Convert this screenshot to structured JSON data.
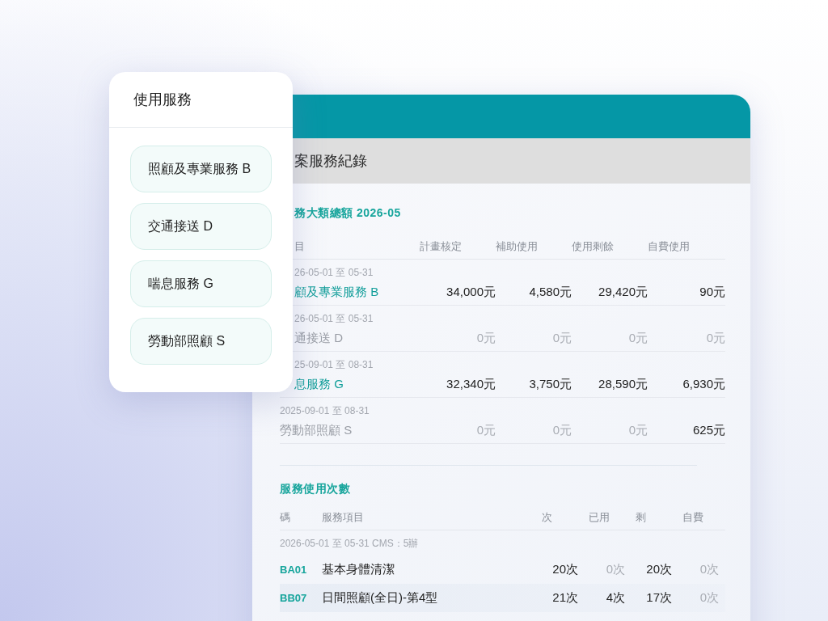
{
  "services_card": {
    "title": "使用服務",
    "items": [
      {
        "label": "照顧及專業服務 B"
      },
      {
        "label": "交通接送 D"
      },
      {
        "label": "喘息服務 G"
      },
      {
        "label": "勞動部照顧 S"
      }
    ]
  },
  "record_panel": {
    "title": "案服務紀錄",
    "summary": {
      "heading": "務大類總額 2026-05",
      "columns": [
        "目",
        "計畫核定",
        "補助使用",
        "使用剩餘",
        "自費使用"
      ],
      "rows": [
        {
          "period": "26-05-01 至 05-31",
          "name": "顧及專業服務 B",
          "active": true,
          "values": [
            {
              "text": "34,000元",
              "muted": false
            },
            {
              "text": "4,580元",
              "muted": false
            },
            {
              "text": "29,420元",
              "muted": false
            },
            {
              "text": "90元",
              "muted": false
            }
          ]
        },
        {
          "period": "26-05-01 至 05-31",
          "name": "通接送 D",
          "active": false,
          "values": [
            {
              "text": "0元",
              "muted": true
            },
            {
              "text": "0元",
              "muted": true
            },
            {
              "text": "0元",
              "muted": true
            },
            {
              "text": "0元",
              "muted": true
            }
          ]
        },
        {
          "period": "25-09-01 至 08-31",
          "name": "息服務 G",
          "active": true,
          "values": [
            {
              "text": "32,340元",
              "muted": false
            },
            {
              "text": "3,750元",
              "muted": false
            },
            {
              "text": "28,590元",
              "muted": false
            },
            {
              "text": "6,930元",
              "muted": false
            }
          ]
        },
        {
          "period": "2025-09-01 至 08-31",
          "name": "勞動部照顧 S",
          "active": false,
          "values": [
            {
              "text": "0元",
              "muted": true
            },
            {
              "text": "0元",
              "muted": true
            },
            {
              "text": "0元",
              "muted": true
            },
            {
              "text": "625元",
              "muted": false
            }
          ]
        }
      ]
    },
    "usage": {
      "heading": "服務使用次數",
      "columns": [
        "碼",
        "服務項目",
        "次",
        "已用",
        "剩",
        "自費"
      ],
      "period": "2026-05-01 至 05-31 CMS：5辦",
      "rows": [
        {
          "code": "BA01",
          "item": "基本身體清潔",
          "values": [
            {
              "text": "20次",
              "muted": false
            },
            {
              "text": "0次",
              "muted": true
            },
            {
              "text": "20次",
              "muted": false
            },
            {
              "text": "0次",
              "muted": true
            }
          ]
        },
        {
          "code": "BB07",
          "item": "日間照顧(全日)-第4型",
          "values": [
            {
              "text": "21次",
              "muted": false
            },
            {
              "text": "4次",
              "muted": false
            },
            {
              "text": "17次",
              "muted": false
            },
            {
              "text": "0次",
              "muted": true
            }
          ]
        }
      ]
    }
  }
}
